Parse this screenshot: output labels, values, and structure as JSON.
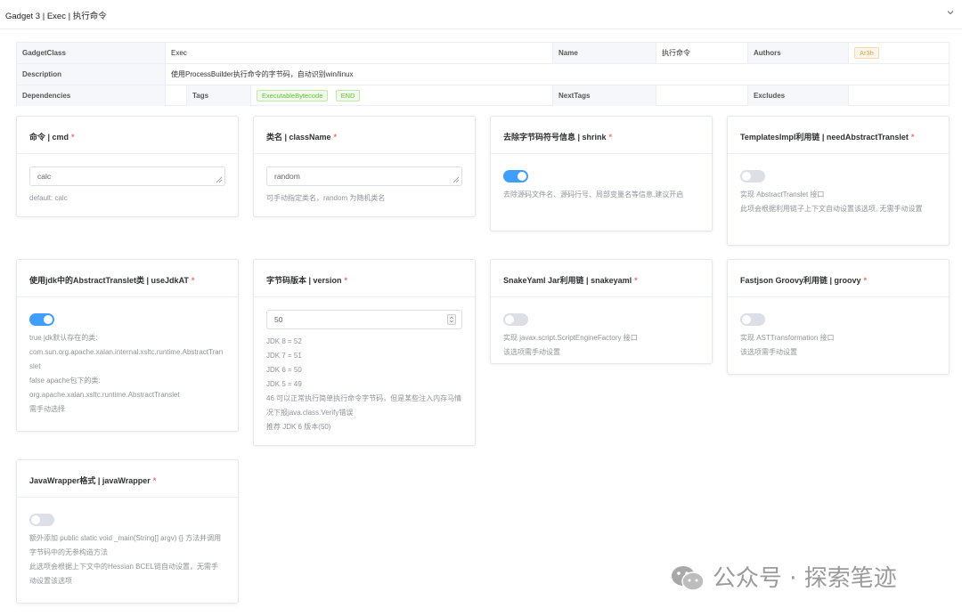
{
  "header": {
    "title": "Gadget 3 | Exec | 执行命令",
    "chevron_icon": "chevron-down-icon"
  },
  "info": {
    "gadget_class_label": "GadgetClass",
    "gadget_class_value": "Exec",
    "name_label": "Name",
    "name_value": "执行命令",
    "authors_label": "Authors",
    "authors_tag": "Ar3h",
    "description_label": "Description",
    "description_value": "使用ProcessBuilder执行命令的字节码，自动识别win/linux",
    "dependencies_label": "Dependencies",
    "tags_label": "Tags",
    "tags": [
      "ExecutableBytecode",
      "END"
    ],
    "nexttags_label": "NextTags",
    "excludes_label": "Excludes"
  },
  "cards": {
    "cmd": {
      "title": "命令 | cmd",
      "required": "*",
      "value": "calc",
      "desc": "default: calc"
    },
    "classname": {
      "title": "类名 | className",
      "required": "*",
      "value": "random",
      "desc": "可手动指定类名，random 为随机类名"
    },
    "shrink": {
      "title": "去除字节码符号信息 | shrink",
      "required": "*",
      "switch_on": true,
      "desc": "去除源码文件名、源码行号、局部变量名等信息,建议开启"
    },
    "templates": {
      "title": "TemplatesImpl利用链 | needAbstractTranslet",
      "required": "*",
      "switch_on": false,
      "desc": "实现 AbstractTranslet 接口\n此项会根据利用链子上下文自动设置该选项, 无需手动设置"
    },
    "usejdkat": {
      "title": "使用jdk中的AbstractTranslet类 | useJdkAT",
      "required": "*",
      "switch_on": true,
      "desc": "true jdk默认存在的类:\ncom.sun.org.apache.xalan.internal.xsltc.runtime.AbstractTranslet\nfalse apache包下的类:\norg.apache.xalan.xsltc.runtime.AbstractTranslet\n需手动选择"
    },
    "version": {
      "title": "字节码版本 | version",
      "required": "*",
      "value": "50",
      "desc": "JDK 8 = 52\nJDK 7 = 51\nJDK 6 = 50\nJDK 5 = 49\n46 可以正常执行简单执行命令字节码，但是某些注入内存马情况下报java.class.Verify错误\n推荐 JDK 6 版本(50)"
    },
    "snakeyaml": {
      "title": "SnakeYaml Jar利用链 | snakeyaml",
      "required": "*",
      "switch_on": false,
      "desc": "实现 javax.script.ScriptEngineFactory 接口\n该选项需手动设置"
    },
    "groovy": {
      "title": "Fastjson Groovy利用链 | groovy",
      "required": "*",
      "switch_on": false,
      "desc": "实现 ASTTransformation 接口\n该选项需手动设置"
    },
    "javawrapper": {
      "title": "JavaWrapper格式 | javaWrapper",
      "required": "*",
      "switch_on": false,
      "desc": "额外添加 public static void _main(String[] argv) {} 方法并调用字节码中的无参构造方法\n此选项会根据上下文中的Hessian BCEL链自动设置，无需手动设置该选项"
    }
  },
  "watermark": {
    "icon": "wechat-icon",
    "text": "公众号 · 探索笔迹"
  }
}
